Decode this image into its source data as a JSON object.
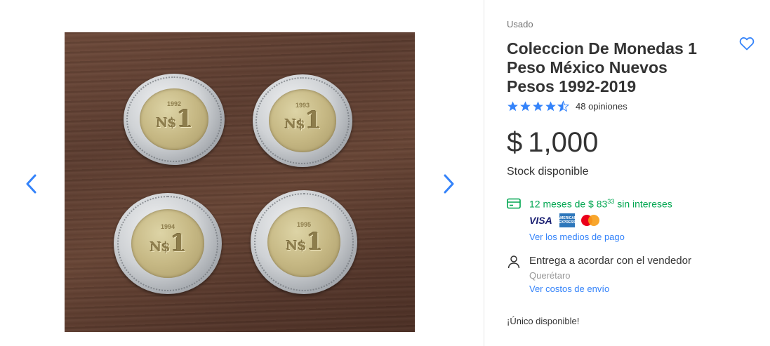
{
  "gallery": {
    "prev_icon": "chevron-left-icon",
    "next_icon": "chevron-right-icon",
    "coins": [
      {
        "year": "1992",
        "label": "N$",
        "value": "1"
      },
      {
        "year": "1993",
        "label": "N$",
        "value": "1"
      },
      {
        "year": "1994",
        "label": "N$",
        "value": "1"
      },
      {
        "year": "1995",
        "label": "N$",
        "value": "1"
      }
    ]
  },
  "product": {
    "condition": "Usado",
    "title": "Coleccion De Monedas 1 Peso México Nuevos Pesos 1992-2019",
    "favorite_icon": "heart-icon",
    "rating": 4.5,
    "reviews_label": "48 opiniones",
    "currency": "$",
    "price": "1,000",
    "stock": "Stock disponible"
  },
  "payment": {
    "installments_prefix": "12 meses de $ 83",
    "installments_cents": "33",
    "installments_suffix": " sin intereses",
    "cards": [
      "VISA",
      "AMERICAN EXPRESS",
      "mastercard"
    ],
    "methods_link": "Ver los medios de pago"
  },
  "shipping": {
    "delivery": "Entrega a acordar con el vendedor",
    "location": "Querétaro",
    "costs_link": "Ver costos de envío"
  },
  "availability": "¡Único disponible!",
  "colors": {
    "accent": "#3483fa",
    "success": "#00a650",
    "text": "#333333",
    "muted": "#737373"
  }
}
